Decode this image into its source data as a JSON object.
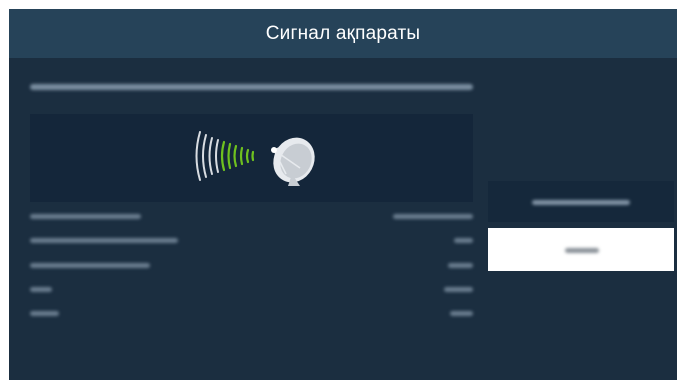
{
  "header": {
    "title": "Сигнал ақпараты"
  },
  "icons": {
    "signal": "signal-waves-icon",
    "antenna": "satellite-dish-icon"
  },
  "colors": {
    "panel": "#1b2e40",
    "header": "#264359",
    "signal_green": "#6fc11f",
    "button_focused": "#ffffff"
  }
}
